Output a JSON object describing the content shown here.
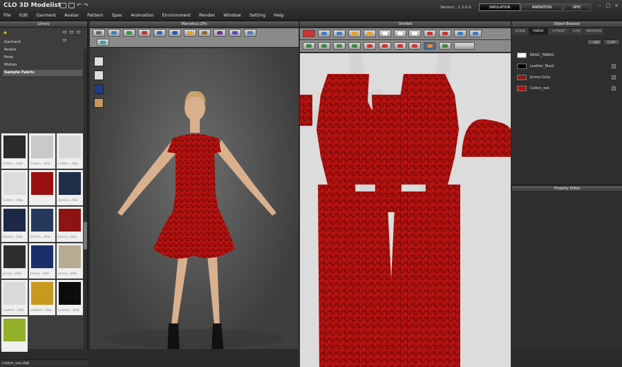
{
  "app": {
    "logo": "CLO 3D Modelist",
    "version": "Version : 1.2.0.0"
  },
  "menu": [
    "File",
    "Edit",
    "Garment",
    "Avatar",
    "Pattern",
    "Spec",
    "Animation",
    "Environment",
    "Render",
    "Window",
    "Setting",
    "Help"
  ],
  "modes": [
    "SIMULATION",
    "ANIMATION",
    "SPEC"
  ],
  "library": {
    "title": "Library",
    "items": [
      "Garment",
      "Avatar",
      "Pose",
      "Motion",
      "Sample Fabric"
    ],
    "selected_item": "Sample Fabric",
    "status": "Cotton_red.zfab",
    "thumbs": [
      {
        "caption": "Cotton...zfab",
        "color": "#2b2b2b"
      },
      {
        "caption": "Cotton...zfab",
        "color": "#c9c9c9"
      },
      {
        "caption": "Cotton...zfab",
        "color": "#d8d8d8"
      },
      {
        "caption": "Cotton...zfab",
        "color": "#dcdcdc"
      },
      {
        "caption": "",
        "color": "#9a1010"
      },
      {
        "caption": "Denim...zfab",
        "color": "#1f2f4a"
      },
      {
        "caption": "Denim...zfab",
        "color": "#1c2a48"
      },
      {
        "caption": "Denim...zfab",
        "color": "#25395c"
      },
      {
        "caption": "Jersey...zfab",
        "color": "#8e1414"
      },
      {
        "caption": "Jersey...zfab",
        "color": "#2e2e2e"
      },
      {
        "caption": "Jersey...zfab",
        "color": "#1a2f6b"
      },
      {
        "caption": "Jersey...zfab",
        "color": "#b7ab93"
      },
      {
        "caption": "Leather...zfab",
        "color": "#d9d9d9"
      },
      {
        "caption": "Leather...zfab",
        "color": "#c79a1e"
      },
      {
        "caption": "Leather...zfab",
        "color": "#0c0c0c"
      },
      {
        "caption": "",
        "color": "#93b02a"
      }
    ]
  },
  "view3d": {
    "title": "Marvelous.ZPrj"
  },
  "view2d": {
    "title": "Untitled"
  },
  "object_browser": {
    "title": "Object Browser",
    "tabs": [
      "SCENE",
      "FABRIC",
      "A-POINT",
      "A-SV",
      "MEASURE"
    ],
    "active_tab": "FABRIC",
    "add_label": "+ ADD",
    "copy_label": "COPY",
    "fabrics": [
      {
        "name": "BASIC_FABRIC",
        "color": "#ffffff"
      },
      {
        "name": "Leather_Black",
        "color": "#000000"
      },
      {
        "name": "Jersey-Gray",
        "color": "#8b1a1a"
      },
      {
        "name": "Cotton_red",
        "color": "#b51414"
      }
    ]
  },
  "property_editor": {
    "title": "Property Editor"
  },
  "colors": {
    "fabric_red": "#b3120f",
    "pattern_dark": "#6a0606",
    "skin": "#d9b08e"
  }
}
